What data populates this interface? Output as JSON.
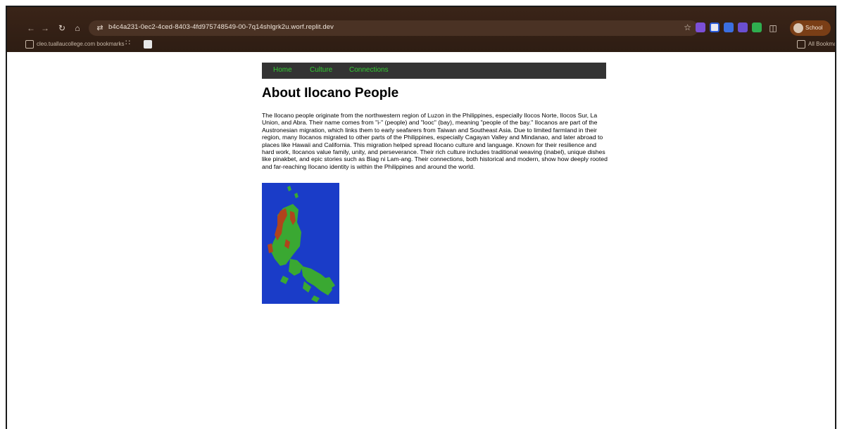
{
  "browser": {
    "url": "b4c4a231-0ec2-4ced-8403-4fd975748549-00-7q14shlgrk2u.worf.replit.dev",
    "profile_label": "School",
    "bookmarks_bar": {
      "folder_label": "cleo.tuallaucollege.com bookmarks",
      "all_bookmarks_label": "All Bookmarks"
    }
  },
  "site": {
    "nav": {
      "items": [
        {
          "label": "Home"
        },
        {
          "label": "Culture"
        },
        {
          "label": "Connections"
        }
      ]
    },
    "title": "About Ilocano People",
    "body_text": "The Ilocano people originate from the northwestern region of Luzon in the Philippines, especially Ilocos Norte, Ilocos Sur, La Union, and Abra. Their name comes from \"i-\" (people) and \"looc\" (bay), meaning \"people of the bay.\" Ilocanos are part of the Austronesian migration, which links them to early seafarers from Taiwan and Southeast Asia. Due to limited farmland in their region, many Ilocanos migrated to other parts of the Philippines, especially Cagayan Valley and Mindanao, and later abroad to places like Hawaii and California. This migration helped spread Ilocano culture and language. Known for their resilience and hard work, Ilocanos value family, unity, and perseverance. Their rich culture includes traditional weaving (inabel), unique dishes like pinakbet, and epic stories such as Biag ni Lam-ang. Their connections, both historical and modern, show how deeply rooted and far-reaching Ilocano identity is within the Philippines and around the world.",
    "map_colors": {
      "sea": "#1a3cc8",
      "land": "#3aa832",
      "region": "#b0441c"
    }
  },
  "icons": {
    "back": "arrow-left-icon",
    "forward": "arrow-right-icon",
    "reload": "reload-icon",
    "home": "home-icon",
    "site_info": "tune-icon",
    "bookmark": "star-icon",
    "extensions": "puzzle-icon",
    "apps": "grid-icon"
  }
}
